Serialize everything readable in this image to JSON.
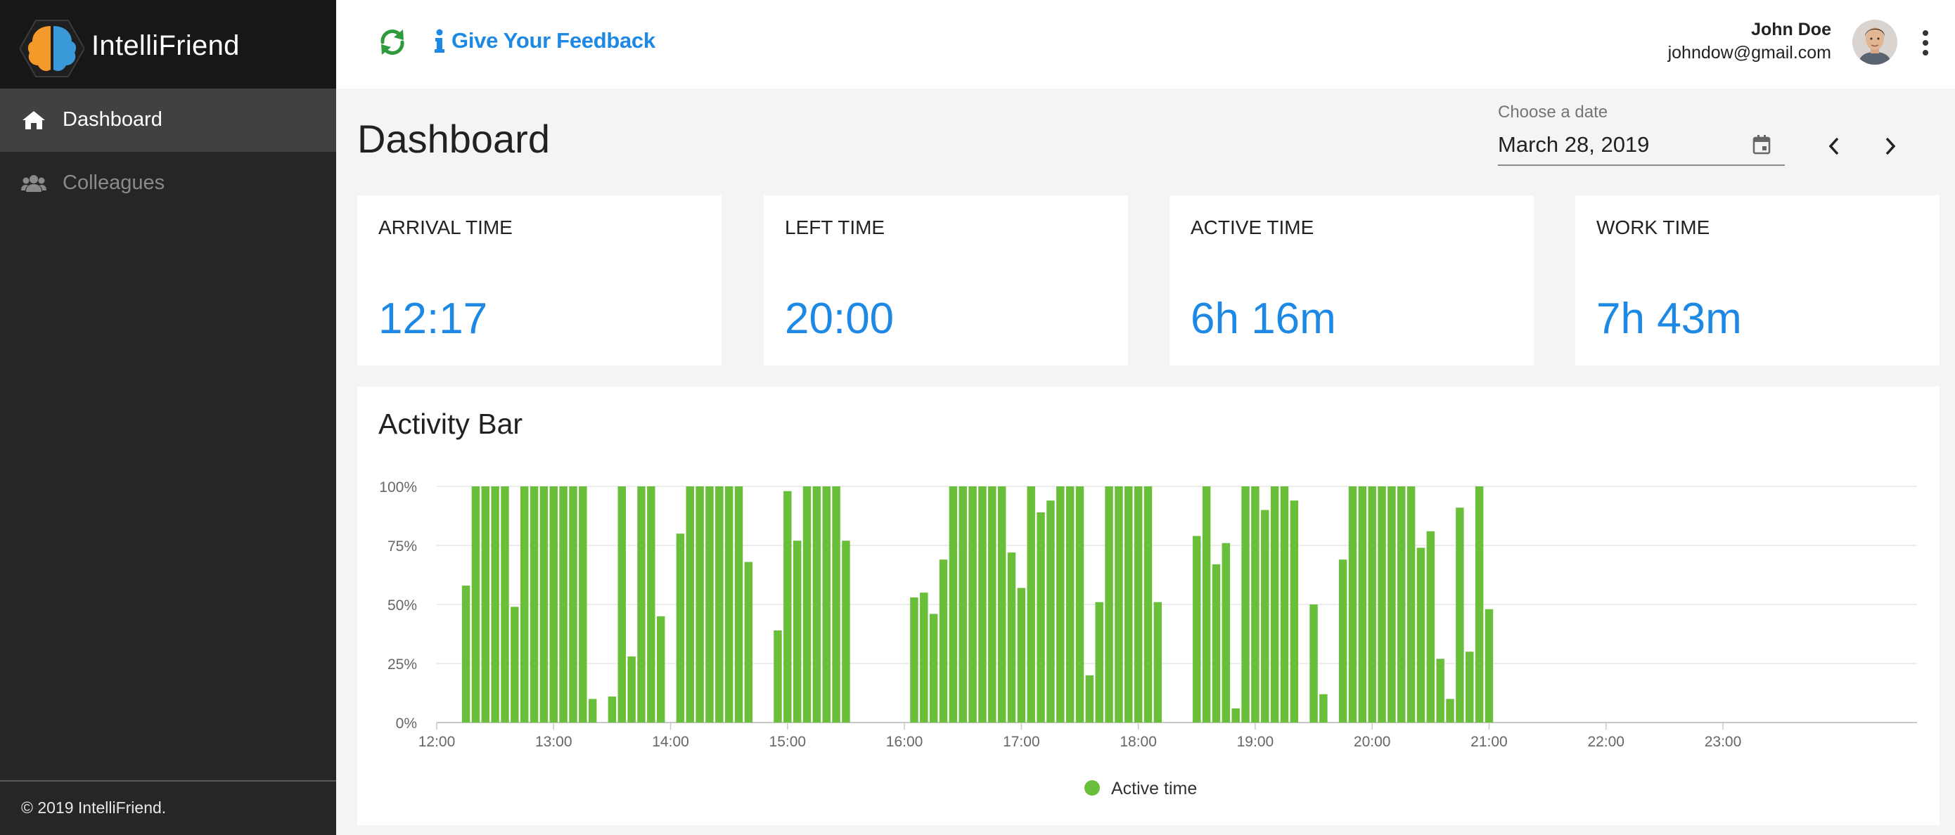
{
  "app": {
    "name": "IntelliFriend",
    "footer": "© 2019 IntelliFriend."
  },
  "sidebar": {
    "items": [
      {
        "label": "Dashboard",
        "icon": "home-icon",
        "active": true
      },
      {
        "label": "Colleagues",
        "icon": "users-icon",
        "active": false
      }
    ]
  },
  "header": {
    "refresh_icon": "refresh-icon",
    "feedback_label": "Give Your Feedback",
    "user": {
      "name": "John Doe",
      "email": "johndow@gmail.com"
    }
  },
  "page": {
    "title": "Dashboard",
    "date_label": "Choose a date",
    "date_value": "March 28, 2019"
  },
  "stats": [
    {
      "title": "ARRIVAL TIME",
      "value": "12:17"
    },
    {
      "title": "LEFT TIME",
      "value": "20:00"
    },
    {
      "title": "ACTIVE TIME",
      "value": "6h 16m"
    },
    {
      "title": "WORK TIME",
      "value": "7h 43m"
    }
  ],
  "colors": {
    "accent": "#1e88e5",
    "bar": "#6abf3a",
    "refresh": "#2e9a3a"
  },
  "chart_data": {
    "type": "bar",
    "title": "Activity Bar",
    "legend": "Active time",
    "legend_position": "bottom-center",
    "ylim": [
      0,
      100
    ],
    "y_ticks": [
      "0%",
      "25%",
      "50%",
      "75%",
      "100%"
    ],
    "x_ticks": [
      "12:00",
      "13:00",
      "14:00",
      "15:00",
      "16:00",
      "17:00",
      "18:00",
      "19:00",
      "20:00",
      "21:00",
      "22:00",
      "23:00"
    ],
    "xlim_hours": [
      12,
      24
    ],
    "bar_minutes": 5,
    "grid": true,
    "series": [
      {
        "name": "Active time",
        "points": [
          [
            "12:15",
            58
          ],
          [
            "12:20",
            100
          ],
          [
            "12:25",
            100
          ],
          [
            "12:30",
            100
          ],
          [
            "12:35",
            100
          ],
          [
            "12:40",
            49
          ],
          [
            "12:45",
            100
          ],
          [
            "12:50",
            100
          ],
          [
            "12:55",
            100
          ],
          [
            "13:00",
            100
          ],
          [
            "13:05",
            100
          ],
          [
            "13:10",
            100
          ],
          [
            "13:15",
            100
          ],
          [
            "13:20",
            10
          ],
          [
            "13:30",
            11
          ],
          [
            "13:35",
            100
          ],
          [
            "13:40",
            28
          ],
          [
            "13:45",
            100
          ],
          [
            "13:50",
            100
          ],
          [
            "13:55",
            45
          ],
          [
            "14:05",
            80
          ],
          [
            "14:10",
            100
          ],
          [
            "14:15",
            100
          ],
          [
            "14:20",
            100
          ],
          [
            "14:25",
            100
          ],
          [
            "14:30",
            100
          ],
          [
            "14:35",
            100
          ],
          [
            "14:40",
            68
          ],
          [
            "14:55",
            39
          ],
          [
            "15:00",
            98
          ],
          [
            "15:05",
            77
          ],
          [
            "15:10",
            100
          ],
          [
            "15:15",
            100
          ],
          [
            "15:20",
            100
          ],
          [
            "15:25",
            100
          ],
          [
            "15:30",
            77
          ],
          [
            "16:05",
            53
          ],
          [
            "16:10",
            55
          ],
          [
            "16:15",
            46
          ],
          [
            "16:20",
            69
          ],
          [
            "16:25",
            100
          ],
          [
            "16:30",
            100
          ],
          [
            "16:35",
            100
          ],
          [
            "16:40",
            100
          ],
          [
            "16:45",
            100
          ],
          [
            "16:50",
            100
          ],
          [
            "16:55",
            72
          ],
          [
            "17:00",
            57
          ],
          [
            "17:05",
            100
          ],
          [
            "17:10",
            89
          ],
          [
            "17:15",
            94
          ],
          [
            "17:20",
            100
          ],
          [
            "17:25",
            100
          ],
          [
            "17:30",
            100
          ],
          [
            "17:35",
            20
          ],
          [
            "17:40",
            51
          ],
          [
            "17:45",
            100
          ],
          [
            "17:50",
            100
          ],
          [
            "17:55",
            100
          ],
          [
            "18:00",
            100
          ],
          [
            "18:05",
            100
          ],
          [
            "18:10",
            51
          ],
          [
            "18:30",
            79
          ],
          [
            "18:35",
            100
          ],
          [
            "18:40",
            67
          ],
          [
            "18:45",
            76
          ],
          [
            "18:50",
            6
          ],
          [
            "18:55",
            100
          ],
          [
            "19:00",
            100
          ],
          [
            "19:05",
            90
          ],
          [
            "19:10",
            100
          ],
          [
            "19:15",
            100
          ],
          [
            "19:20",
            94
          ],
          [
            "19:30",
            50
          ],
          [
            "19:35",
            12
          ],
          [
            "19:45",
            69
          ],
          [
            "19:50",
            100
          ],
          [
            "19:55",
            100
          ],
          [
            "20:00",
            100
          ],
          [
            "20:05",
            100
          ],
          [
            "20:10",
            100
          ],
          [
            "20:15",
            100
          ],
          [
            "20:20",
            100
          ],
          [
            "20:25",
            74
          ],
          [
            "20:30",
            81
          ],
          [
            "20:35",
            27
          ],
          [
            "20:40",
            10
          ],
          [
            "20:45",
            91
          ],
          [
            "20:50",
            30
          ],
          [
            "20:55",
            100
          ],
          [
            "21:00",
            48
          ]
        ]
      }
    ]
  }
}
